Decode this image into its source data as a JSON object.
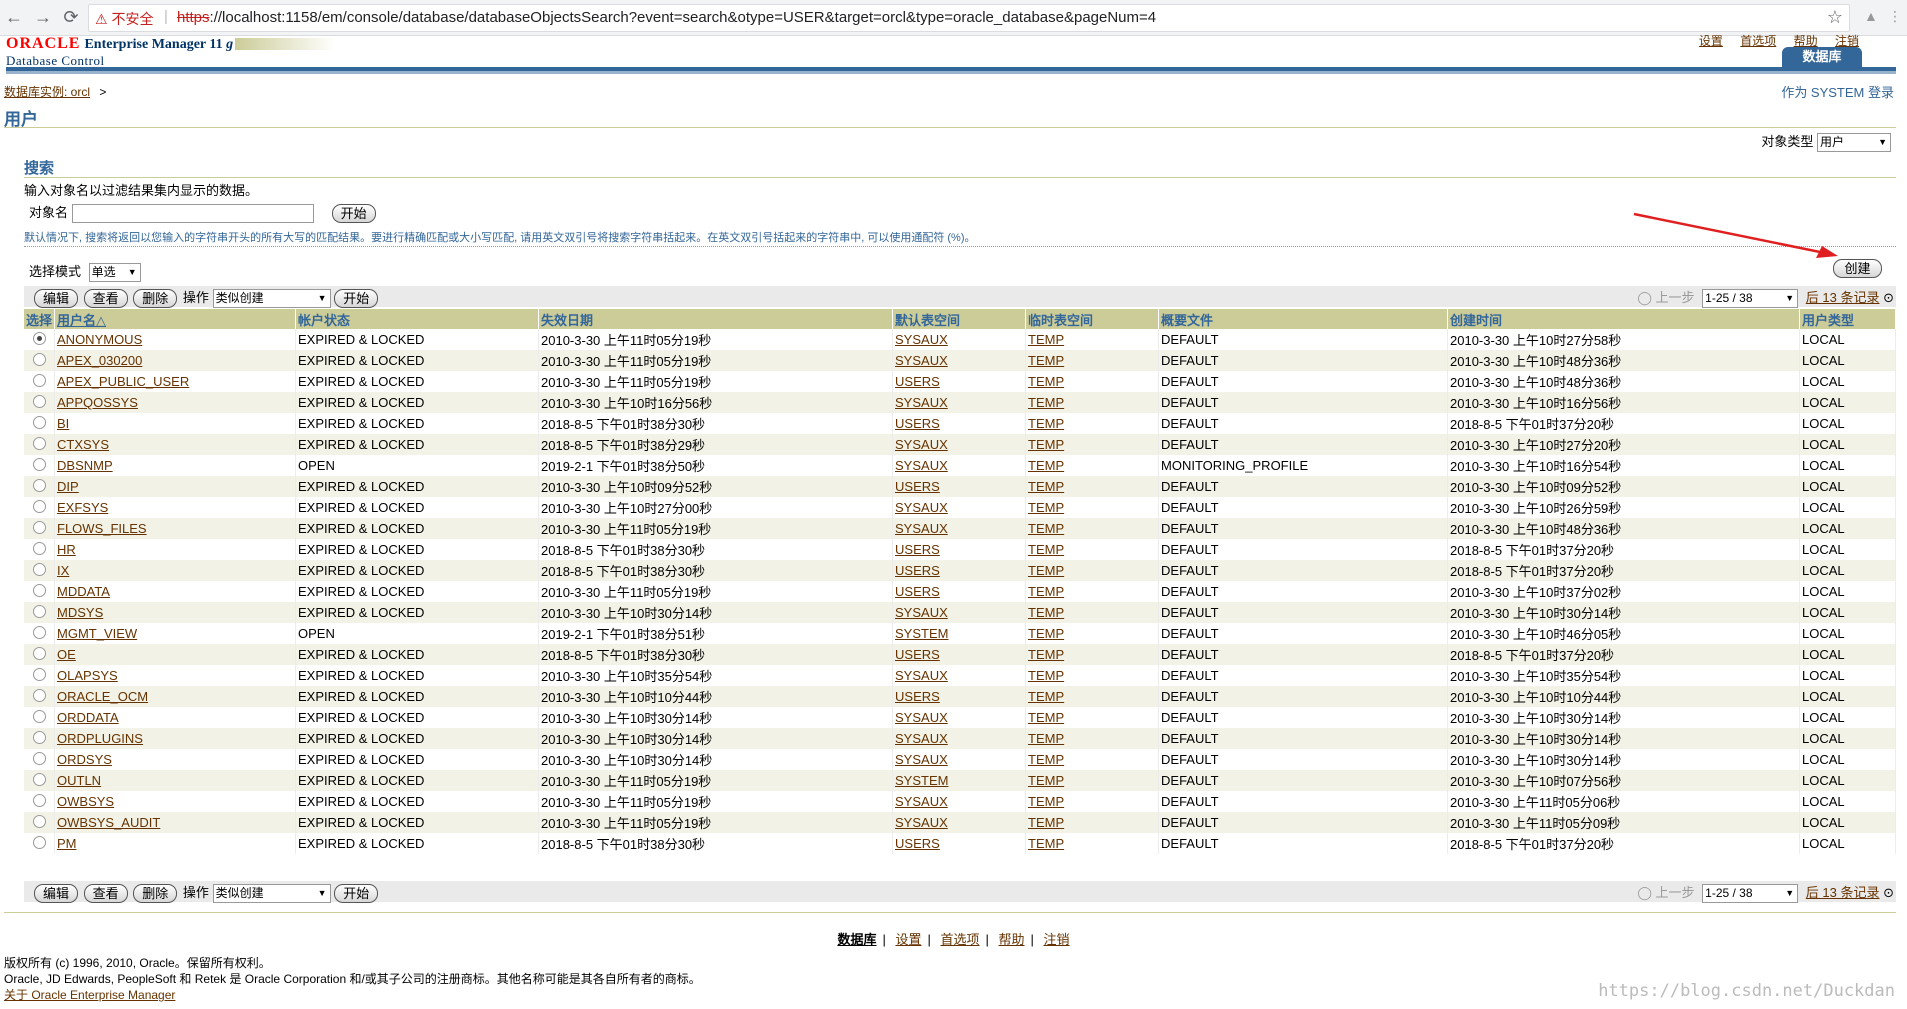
{
  "browser": {
    "security_label": "不安全",
    "url_scheme": "https",
    "url_rest": "://localhost:1158/em/console/database/databaseObjectsSearch?event=search&otype=USER&target=orcl&type=oracle_database&pageNum=4"
  },
  "header": {
    "logo_oracle": "ORACLE",
    "logo_product": "Enterprise Manager 11",
    "logo_version_g": "g",
    "logo_subtitle": "Database Control",
    "global_links": [
      "设置",
      "首选项",
      "帮助",
      "注销"
    ],
    "tab_database": "数据库"
  },
  "breadcrumb": {
    "instance_link": "数据库实例: orcl",
    "sep": ">"
  },
  "login_as": "作为 SYSTEM 登录",
  "page_title": "用户",
  "object_type": {
    "label": "对象类型",
    "value": "用户"
  },
  "search": {
    "header": "搜索",
    "description": "输入对象名以过滤结果集内显示的数据。",
    "field_label": "对象名",
    "go_label": "开始",
    "tip": "默认情况下, 搜索将返回以您输入的字符串开头的所有大写的匹配结果。要进行精确匹配或大小写匹配, 请用英文双引号将搜索字符串括起来。在英文双引号括起来的字符串中, 可以使用通配符 (%)。"
  },
  "create_label": "创建",
  "select_mode": {
    "label": "选择模式",
    "value": "单选"
  },
  "toolbar": {
    "edit": "编辑",
    "view": "查看",
    "delete": "删除",
    "action_label": "操作",
    "action_value": "类似创建",
    "go": "开始",
    "prev": "上一步",
    "range": "1-25 / 38",
    "next": "后 13 条记录"
  },
  "table": {
    "headers": [
      "选择",
      "用户名△",
      "帐户状态",
      "失效日期",
      "默认表空间",
      "临时表空间",
      "概要文件",
      "创建时间",
      "用户类型"
    ],
    "rows": [
      [
        "ANONYMOUS",
        "EXPIRED & LOCKED",
        "2010-3-30 上午11时05分19秒",
        "SYSAUX",
        "TEMP",
        "DEFAULT",
        "2010-3-30 上午10时27分58秒",
        "LOCAL"
      ],
      [
        "APEX_030200",
        "EXPIRED & LOCKED",
        "2010-3-30 上午11时05分19秒",
        "SYSAUX",
        "TEMP",
        "DEFAULT",
        "2010-3-30 上午10时48分36秒",
        "LOCAL"
      ],
      [
        "APEX_PUBLIC_USER",
        "EXPIRED & LOCKED",
        "2010-3-30 上午11时05分19秒",
        "USERS",
        "TEMP",
        "DEFAULT",
        "2010-3-30 上午10时48分36秒",
        "LOCAL"
      ],
      [
        "APPQOSSYS",
        "EXPIRED & LOCKED",
        "2010-3-30 上午10时16分56秒",
        "SYSAUX",
        "TEMP",
        "DEFAULT",
        "2010-3-30 上午10时16分56秒",
        "LOCAL"
      ],
      [
        "BI",
        "EXPIRED & LOCKED",
        "2018-8-5 下午01时38分30秒",
        "USERS",
        "TEMP",
        "DEFAULT",
        "2018-8-5 下午01时37分20秒",
        "LOCAL"
      ],
      [
        "CTXSYS",
        "EXPIRED & LOCKED",
        "2018-8-5 下午01时38分29秒",
        "SYSAUX",
        "TEMP",
        "DEFAULT",
        "2010-3-30 上午10时27分20秒",
        "LOCAL"
      ],
      [
        "DBSNMP",
        "OPEN",
        "2019-2-1 下午01时38分50秒",
        "SYSAUX",
        "TEMP",
        "MONITORING_PROFILE",
        "2010-3-30 上午10时16分54秒",
        "LOCAL"
      ],
      [
        "DIP",
        "EXPIRED & LOCKED",
        "2010-3-30 上午10时09分52秒",
        "USERS",
        "TEMP",
        "DEFAULT",
        "2010-3-30 上午10时09分52秒",
        "LOCAL"
      ],
      [
        "EXFSYS",
        "EXPIRED & LOCKED",
        "2010-3-30 上午10时27分00秒",
        "SYSAUX",
        "TEMP",
        "DEFAULT",
        "2010-3-30 上午10时26分59秒",
        "LOCAL"
      ],
      [
        "FLOWS_FILES",
        "EXPIRED & LOCKED",
        "2010-3-30 上午11时05分19秒",
        "SYSAUX",
        "TEMP",
        "DEFAULT",
        "2010-3-30 上午10时48分36秒",
        "LOCAL"
      ],
      [
        "HR",
        "EXPIRED & LOCKED",
        "2018-8-5 下午01时38分30秒",
        "USERS",
        "TEMP",
        "DEFAULT",
        "2018-8-5 下午01时37分20秒",
        "LOCAL"
      ],
      [
        "IX",
        "EXPIRED & LOCKED",
        "2018-8-5 下午01时38分30秒",
        "USERS",
        "TEMP",
        "DEFAULT",
        "2018-8-5 下午01时37分20秒",
        "LOCAL"
      ],
      [
        "MDDATA",
        "EXPIRED & LOCKED",
        "2010-3-30 上午11时05分19秒",
        "USERS",
        "TEMP",
        "DEFAULT",
        "2010-3-30 上午10时37分02秒",
        "LOCAL"
      ],
      [
        "MDSYS",
        "EXPIRED & LOCKED",
        "2010-3-30 上午10时30分14秒",
        "SYSAUX",
        "TEMP",
        "DEFAULT",
        "2010-3-30 上午10时30分14秒",
        "LOCAL"
      ],
      [
        "MGMT_VIEW",
        "OPEN",
        "2019-2-1 下午01时38分51秒",
        "SYSTEM",
        "TEMP",
        "DEFAULT",
        "2010-3-30 上午10时46分05秒",
        "LOCAL"
      ],
      [
        "OE",
        "EXPIRED & LOCKED",
        "2018-8-5 下午01时38分30秒",
        "USERS",
        "TEMP",
        "DEFAULT",
        "2018-8-5 下午01时37分20秒",
        "LOCAL"
      ],
      [
        "OLAPSYS",
        "EXPIRED & LOCKED",
        "2010-3-30 上午10时35分54秒",
        "SYSAUX",
        "TEMP",
        "DEFAULT",
        "2010-3-30 上午10时35分54秒",
        "LOCAL"
      ],
      [
        "ORACLE_OCM",
        "EXPIRED & LOCKED",
        "2010-3-30 上午10时10分44秒",
        "USERS",
        "TEMP",
        "DEFAULT",
        "2010-3-30 上午10时10分44秒",
        "LOCAL"
      ],
      [
        "ORDDATA",
        "EXPIRED & LOCKED",
        "2010-3-30 上午10时30分14秒",
        "SYSAUX",
        "TEMP",
        "DEFAULT",
        "2010-3-30 上午10时30分14秒",
        "LOCAL"
      ],
      [
        "ORDPLUGINS",
        "EXPIRED & LOCKED",
        "2010-3-30 上午10时30分14秒",
        "SYSAUX",
        "TEMP",
        "DEFAULT",
        "2010-3-30 上午10时30分14秒",
        "LOCAL"
      ],
      [
        "ORDSYS",
        "EXPIRED & LOCKED",
        "2010-3-30 上午10时30分14秒",
        "SYSAUX",
        "TEMP",
        "DEFAULT",
        "2010-3-30 上午10时30分14秒",
        "LOCAL"
      ],
      [
        "OUTLN",
        "EXPIRED & LOCKED",
        "2010-3-30 上午11时05分19秒",
        "SYSTEM",
        "TEMP",
        "DEFAULT",
        "2010-3-30 上午10时07分56秒",
        "LOCAL"
      ],
      [
        "OWBSYS",
        "EXPIRED & LOCKED",
        "2010-3-30 上午11时05分19秒",
        "SYSAUX",
        "TEMP",
        "DEFAULT",
        "2010-3-30 上午11时05分06秒",
        "LOCAL"
      ],
      [
        "OWBSYS_AUDIT",
        "EXPIRED & LOCKED",
        "2010-3-30 上午11时05分19秒",
        "SYSAUX",
        "TEMP",
        "DEFAULT",
        "2010-3-30 上午11时05分09秒",
        "LOCAL"
      ],
      [
        "PM",
        "EXPIRED & LOCKED",
        "2018-8-5 下午01时38分30秒",
        "USERS",
        "TEMP",
        "DEFAULT",
        "2018-8-5 下午01时37分20秒",
        "LOCAL"
      ]
    ]
  },
  "footer": {
    "links": [
      "数据库",
      "设置",
      "首选项",
      "帮助",
      "注销"
    ],
    "copyright_1": "版权所有 (c) 1996, 2010, Oracle。保留所有权利。",
    "copyright_2": "Oracle, JD Edwards, PeopleSoft 和 Retek 是 Oracle Corporation 和/或其子公司的注册商标。其他名称可能是其各自所有者的商标。",
    "about_link": "关于 Oracle Enterprise Manager",
    "watermark": "https://blog.csdn.net/Duckdan"
  },
  "colors": {
    "brand_blue": "#336699",
    "header_tan": "#cccc99",
    "link_brown": "#663300",
    "oracle_red": "#ff0000",
    "annotation_red": "#e02020"
  }
}
